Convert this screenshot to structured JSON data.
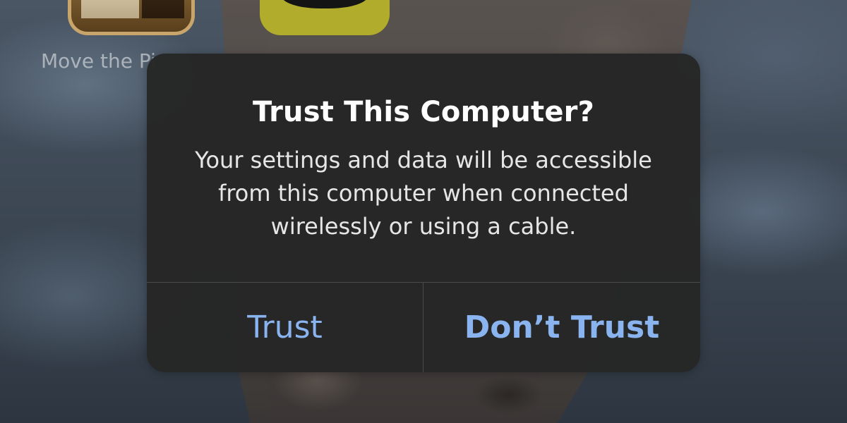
{
  "home_screen": {
    "app_label": "Move the Pi"
  },
  "alert": {
    "title": "Trust This Computer?",
    "message": "Your settings and data will be accessible from this computer when connected wirelessly or using a cable.",
    "buttons": {
      "trust_label": "Trust",
      "dont_trust_label": "Don’t Trust"
    }
  },
  "colors": {
    "button_text": "#8ab4f0",
    "alert_background": "#262626",
    "title_text": "#ffffff"
  }
}
